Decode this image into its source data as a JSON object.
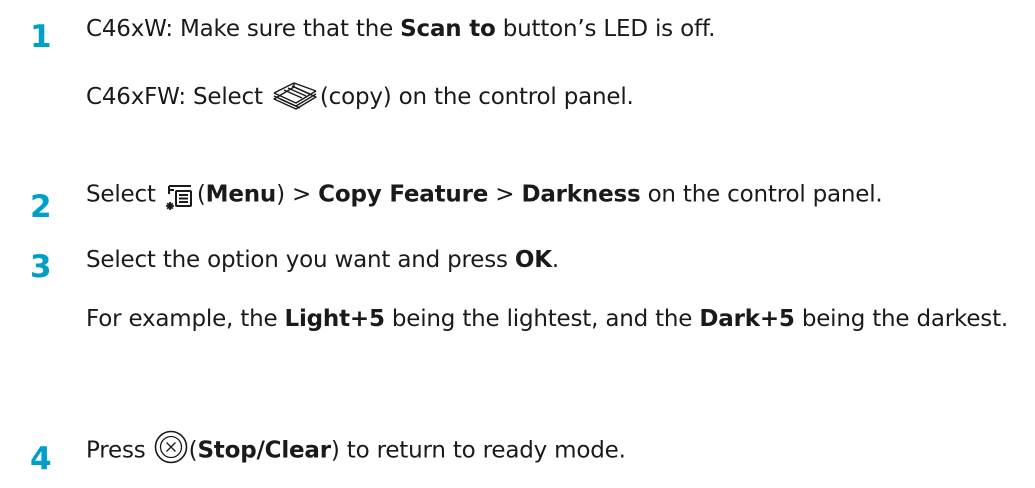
{
  "step1": {
    "number": "1",
    "line_a": {
      "prefix": "C46xW: Make sure that the ",
      "bold": "Scan to",
      "suffix": " button’s LED is off."
    },
    "line_b": {
      "prefix": "C46xFW: Select ",
      "suffix": "(copy) on the control panel.",
      "icon": "copy-icon"
    }
  },
  "step2": {
    "number": "2",
    "prefix": "Select ",
    "icon": "menu-icon",
    "paren_open": "(",
    "menu": "Menu",
    "paren_close": ")",
    "sep1": " > ",
    "copy_feature": "Copy Feature",
    "sep2": " > ",
    "darkness": "Darkness",
    "suffix": " on the control panel."
  },
  "step3": {
    "number": "3",
    "line_a": {
      "prefix": "Select the option you want and press ",
      "bold": "OK",
      "suffix": "."
    },
    "line_b": {
      "prefix": "For example, the ",
      "bold1": "Light+5",
      "mid": " being the lightest, and the ",
      "bold2": "Dark+5",
      "suffix": " being the darkest."
    }
  },
  "step4": {
    "number": "4",
    "prefix": "Press ",
    "icon": "stop-clear-icon",
    "paren_open": "(",
    "bold": "Stop/Clear",
    "paren_close": ")",
    "suffix": " to return to ready mode."
  },
  "colors": {
    "step_number": "#00a0c6",
    "text": "#1a1a1a"
  }
}
